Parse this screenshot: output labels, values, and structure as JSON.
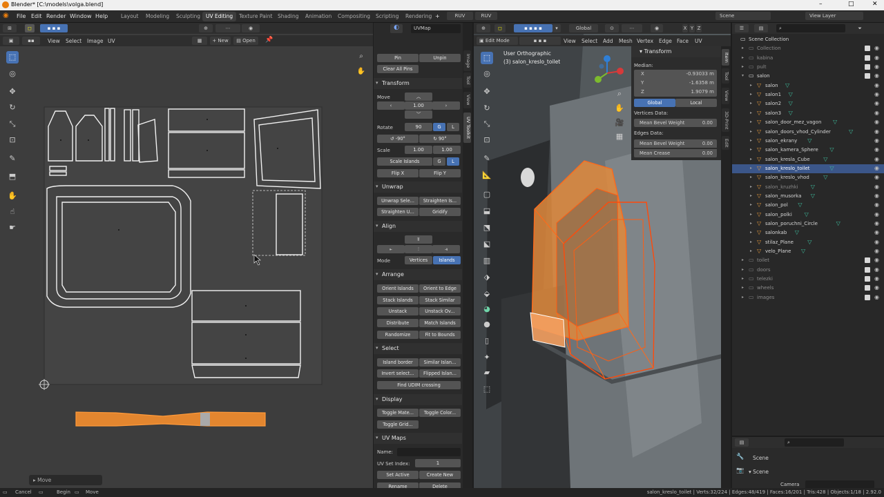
{
  "title_bar": {
    "title": "Blender* [C:\\models\\volga.blend]",
    "minimize": "–",
    "maximize": "□",
    "close": "✕"
  },
  "menu": {
    "items": [
      "File",
      "Edit",
      "Render",
      "Window",
      "Help"
    ]
  },
  "workspaces": [
    "Layout",
    "Modeling",
    "Sculpting",
    "UV Editing",
    "Texture Paint",
    "Shading",
    "Animation",
    "Compositing",
    "Scripting",
    "Rendering"
  ],
  "active_workspace": "UV Editing",
  "addon_buttons": [
    "RUV",
    "RUV"
  ],
  "scene": {
    "label": "Scene",
    "view_layer": "View Layer"
  },
  "uv_editor": {
    "menus": [
      "View",
      "Select",
      "Image",
      "UV"
    ],
    "new_label": "New",
    "open_label": "Open",
    "uvmap": "UVMap",
    "tabs": [
      "Image",
      "Tool",
      "View",
      "UV Toolkit"
    ],
    "operator_panel": "Move",
    "sidebar": {
      "pin": "Pin",
      "unpin": "Unpin",
      "clear_pins": "Clear All Pins",
      "transform": {
        "header": "Transform",
        "move_label": "Move",
        "move_value": "1.00",
        "rotate_label": "Rotate",
        "rotate_value": "90",
        "g": "G",
        "l": "L",
        "rot_neg": "-90°",
        "rot_pos": "90°",
        "scale_label": "Scale",
        "scale_x": "1.00",
        "scale_y": "1.00",
        "scale_islands": "Scale Islands",
        "flip_x": "Flip X",
        "flip_y": "Flip Y"
      },
      "unwrap": {
        "header": "Unwrap",
        "items": [
          "Unwrap Sele...",
          "Straighten Is...",
          "Straighten U...",
          "Gridify"
        ]
      },
      "align": {
        "header": "Align",
        "mode_label": "Mode",
        "vertices": "Vertices",
        "islands": "Islands"
      },
      "arrange": {
        "header": "Arrange",
        "items": [
          "Orient Islands",
          "Orient to Edge",
          "Stack Islands",
          "Stack Similar",
          "Unstack",
          "Unstack Ov...",
          "Distribute",
          "Match Islands",
          "Randomize",
          "Fit to Bounds"
        ]
      },
      "select": {
        "header": "Select",
        "items": [
          "Island border",
          "Similar Islan...",
          "Invert select...",
          "Flipped Islan..."
        ],
        "find_udim": "Find UDIM crossing"
      },
      "display": {
        "header": "Display",
        "items": [
          "Toggle Mate...",
          "Toggle Color...",
          "Toggle Grid..."
        ]
      },
      "uv_maps": {
        "header": "UV Maps",
        "name_label": "Name:",
        "set_index_label": "UV Set Index:",
        "set_index": "1",
        "set_active": "Set Active",
        "create_new": "Create New",
        "rename": "Rename",
        "delete": "Delete"
      }
    }
  },
  "viewport": {
    "mode": "Edit Mode",
    "menus": [
      "View",
      "Select",
      "Add",
      "Mesh",
      "Vertex",
      "Edge",
      "Face",
      "UV"
    ],
    "orientation": "Global",
    "axes": [
      "X",
      "Y",
      "Z"
    ],
    "view_name": "User Orthographic",
    "object_name": "(3) salon_kreslo_toilet",
    "tabs": [
      "Item",
      "Tool",
      "View",
      "3D-Print",
      "Edit"
    ],
    "n_panel": {
      "header": "Transform",
      "median": "Median:",
      "x_label": "X",
      "x": "-0.93033 m",
      "y_label": "Y",
      "y": "-1.6358 m",
      "z_label": "Z",
      "z": "1.9079 m",
      "global": "Global",
      "local": "Local",
      "vertices_data": "Vertices Data:",
      "mean_bevel_weight": "Mean Bevel Weight",
      "vbw": "0.00",
      "edges_data": "Edges Data:",
      "ebw": "0.00",
      "mean_crease": "Mean Crease",
      "crease": "0.00"
    }
  },
  "outliner": {
    "rows": [
      {
        "name": "Scene Collection",
        "level": 0,
        "kind": "scene"
      },
      {
        "name": "Collection",
        "level": 1,
        "kind": "coll",
        "dim": true
      },
      {
        "name": "kabina",
        "level": 1,
        "kind": "coll",
        "dim": true
      },
      {
        "name": "pult",
        "level": 1,
        "kind": "coll",
        "dim": true
      },
      {
        "name": "salon",
        "level": 1,
        "kind": "coll"
      },
      {
        "name": "salon",
        "level": 2,
        "kind": "obj"
      },
      {
        "name": "salon1",
        "level": 2,
        "kind": "obj"
      },
      {
        "name": "salon2",
        "level": 2,
        "kind": "obj"
      },
      {
        "name": "salon3",
        "level": 2,
        "kind": "obj"
      },
      {
        "name": "salon_door_mez_vagon",
        "level": 2,
        "kind": "obj"
      },
      {
        "name": "salon_doors_vhod_Cylinder",
        "level": 2,
        "kind": "obj"
      },
      {
        "name": "salon_ekrany",
        "level": 2,
        "kind": "obj"
      },
      {
        "name": "salon_kamera_Sphere",
        "level": 2,
        "kind": "obj"
      },
      {
        "name": "salon_kresla_Cube",
        "level": 2,
        "kind": "obj"
      },
      {
        "name": "salon_kreslo_toilet",
        "level": 2,
        "kind": "obj",
        "selected": true
      },
      {
        "name": "salon_kreslo_vhod",
        "level": 2,
        "kind": "obj"
      },
      {
        "name": "salon_kruzhki",
        "level": 2,
        "kind": "obj",
        "dim": true
      },
      {
        "name": "salon_musorka",
        "level": 2,
        "kind": "obj"
      },
      {
        "name": "salon_pol",
        "level": 2,
        "kind": "obj"
      },
      {
        "name": "salon_polki",
        "level": 2,
        "kind": "obj"
      },
      {
        "name": "salon_poruchni_Circle",
        "level": 2,
        "kind": "obj"
      },
      {
        "name": "salonkab",
        "level": 2,
        "kind": "obj"
      },
      {
        "name": "stilaz_Plane",
        "level": 2,
        "kind": "obj"
      },
      {
        "name": "velo_Plane",
        "level": 2,
        "kind": "obj"
      },
      {
        "name": "toilet",
        "level": 1,
        "kind": "coll",
        "dim": true
      },
      {
        "name": "doors",
        "level": 1,
        "kind": "coll",
        "dim": true
      },
      {
        "name": "telezki",
        "level": 1,
        "kind": "coll",
        "dim": true
      },
      {
        "name": "wheels",
        "level": 1,
        "kind": "coll",
        "dim": true
      },
      {
        "name": "images",
        "level": 1,
        "kind": "coll",
        "dim": true
      }
    ]
  },
  "properties": {
    "scene_name": "Scene",
    "panel": "Scene",
    "camera_label": "Camera"
  },
  "status": {
    "left": [
      "Cancel",
      "Begin",
      "Move"
    ],
    "right": "salon_kreslo_toilet | Verts:32/224 | Edges:48/419 | Faces:16/201 | Tris:428 | Objects:1/18 | 2.92.0"
  }
}
